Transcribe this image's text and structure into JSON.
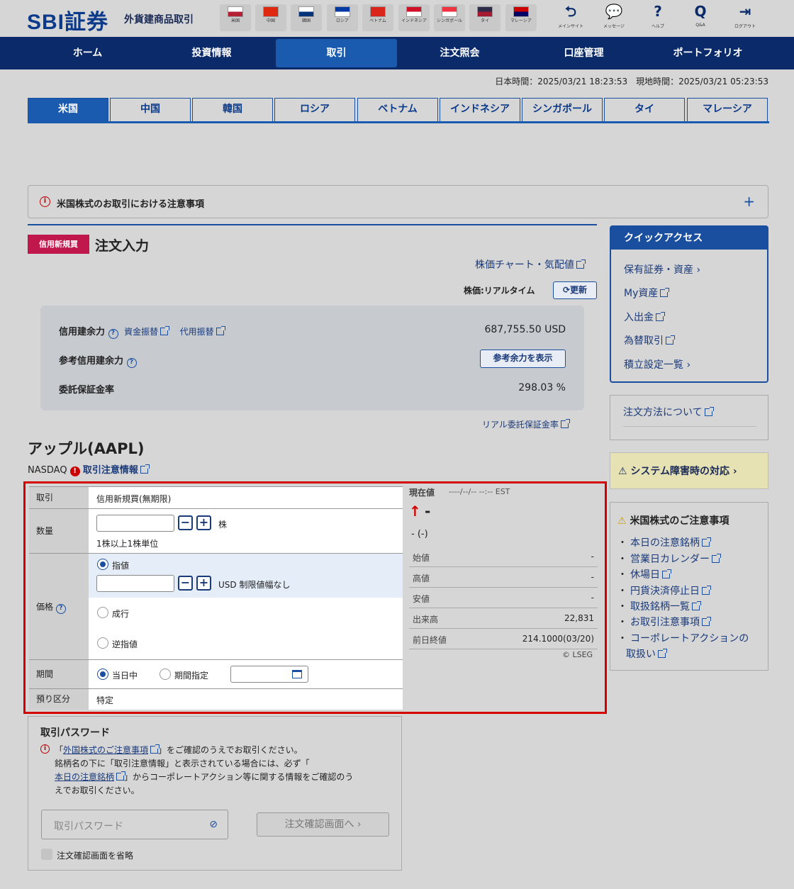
{
  "header": {
    "logo": "SBI証券",
    "subtitle": "外貨建商品取引",
    "flags": [
      {
        "label": "米国",
        "c": "#ffffff",
        "s": "#b22234"
      },
      {
        "label": "中国",
        "c": "#de2910",
        "s": "#de2910"
      },
      {
        "label": "韓国",
        "c": "#ffffff",
        "s": "#003478"
      },
      {
        "label": "ロシア",
        "c": "#0039a6",
        "s": "#ffffff"
      },
      {
        "label": "ベトナム",
        "c": "#da251d",
        "s": "#da251d"
      },
      {
        "label": "インドネシア",
        "c": "#ce1126",
        "s": "#ffffff"
      },
      {
        "label": "シンガポール",
        "c": "#ef3340",
        "s": "#ffffff"
      },
      {
        "label": "タイ",
        "c": "#2d2a4a",
        "s": "#a51931"
      },
      {
        "label": "マレーシア",
        "c": "#cc0001",
        "s": "#010066"
      }
    ],
    "icons": [
      {
        "label": "メインサイト"
      },
      {
        "label": "メッセージ"
      },
      {
        "label": "ヘルプ"
      },
      {
        "label": "Q&A"
      },
      {
        "label": "ログアウト"
      }
    ]
  },
  "nav": [
    "ホーム",
    "投資情報",
    "取引",
    "注文照会",
    "口座管理",
    "ポートフォリオ"
  ],
  "clock": "日本時間：2025/03/21 18:23:53　現地時間：2025/03/21 05:23:53",
  "country_tabs": [
    "米国",
    "中国",
    "韓国",
    "ロシア",
    "ベトナム",
    "インドネシア",
    "シンガポール",
    "タイ",
    "マレーシア"
  ],
  "notice": "米国株式のお取引における注意事項",
  "notice_plus": "+",
  "order_badge": "信用新規買",
  "order_title": "注文入力",
  "chart_link": "株価チャート・気配値",
  "price_mode": "株価:リアルタイム",
  "refresh": "更新",
  "credit": {
    "label1": "信用建余力",
    "link1": "資金振替",
    "link2": "代用振替",
    "value1": "687,755.50 USD",
    "label2": "参考信用建余力",
    "btn2": "参考余力を表示",
    "label3": "委託保証金率",
    "value3": "298.03 %"
  },
  "real_margin_link": "リアル委託保証金率",
  "stock": {
    "name": "アップル(AAPL)",
    "market": "NASDAQ",
    "caution": "取引注意情報"
  },
  "form": {
    "trade_label": "取引",
    "trade_value": "信用新規買(無期限)",
    "qty_label": "数量",
    "qty_unit": "株",
    "qty_note": "1株以上1株単位",
    "price_label": "価格",
    "limit": "指値",
    "limit_unit": "USD 制限値幅なし",
    "market": "成行",
    "stop": "逆指値",
    "period_label": "期間",
    "today": "当日中",
    "period_spec": "期間指定",
    "account_label": "預り区分",
    "account_value": "特定"
  },
  "quote": {
    "label": "現在値",
    "time": "----/--/-- --:-- EST",
    "arrow": "↑",
    "price": "-",
    "change": "- (-)",
    "rows": [
      {
        "k": "始値",
        "v": "-"
      },
      {
        "k": "高値",
        "v": "-"
      },
      {
        "k": "安値",
        "v": "-"
      },
      {
        "k": "出来高",
        "v": "22,831"
      },
      {
        "k": "前日終値",
        "v": "214.1000(03/20)"
      }
    ],
    "credit": "© LSEG"
  },
  "password": {
    "title": "取引パスワード",
    "line1a": "「",
    "line1link": "外国株式のご注意事項",
    "line1b": "」をご確認のうえでお取引ください。",
    "line2": "銘柄名の下に「取引注意情報」と表示されている場合には、必ず「",
    "line3link": "本日の注意銘柄",
    "line3b": "」からコーポレートアクション等に関する情報をご確認のう",
    "line4": "えでお取引ください。",
    "placeholder": "取引パスワード",
    "confirm_btn": "注文確認画面へ ›",
    "skip": "注文確認画面を省略"
  },
  "quick": {
    "title": "クイックアクセス",
    "items": [
      "保有証券・資産 ›",
      "My資産",
      "入出金",
      "為替取引",
      "積立設定一覧 ›"
    ]
  },
  "howto": "注文方法について",
  "system": "⚠ システム障害時の対応 ›",
  "us_notes": {
    "title": "米国株式のご注意事項",
    "items": [
      "本日の注意銘柄",
      "営業日カレンダー",
      "休場日",
      "円貨決済停止日",
      "取扱銘柄一覧",
      "お取引注意事項",
      "コーポレートアクションの",
      "取扱い"
    ]
  }
}
